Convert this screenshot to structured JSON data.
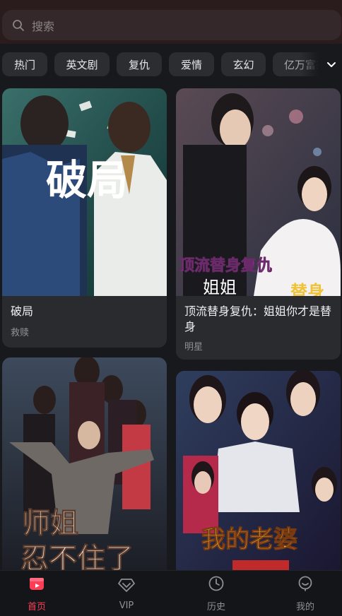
{
  "search": {
    "placeholder": "搜索"
  },
  "categories": [
    "热门",
    "英文剧",
    "复仇",
    "爱情",
    "玄幻",
    "亿万富翁"
  ],
  "dramas": [
    {
      "title": "破局",
      "tag": "救赎",
      "poster_text": "破局"
    },
    {
      "title": "顶流替身复仇：姐姐你才是替身",
      "tag": "明星",
      "poster_text_1": "顶流替身复仇",
      "poster_text_2": "姐姐",
      "poster_text_3": "替身"
    },
    {
      "title": "",
      "tag": "",
      "poster_text_1": "师姐",
      "poster_text_2": "忍不住了"
    },
    {
      "title": "",
      "tag": "",
      "poster_text_1": "我的老婆"
    }
  ],
  "tabs": [
    {
      "label": "首页",
      "icon": "home-icon",
      "active": true
    },
    {
      "label": "VIP",
      "icon": "vip-icon",
      "active": false
    },
    {
      "label": "历史",
      "icon": "history-icon",
      "active": false
    },
    {
      "label": "我的",
      "icon": "profile-icon",
      "active": false
    }
  ],
  "colors": {
    "accent": "#ff3d57",
    "background": "#18191d",
    "card": "#2a2b2f"
  }
}
